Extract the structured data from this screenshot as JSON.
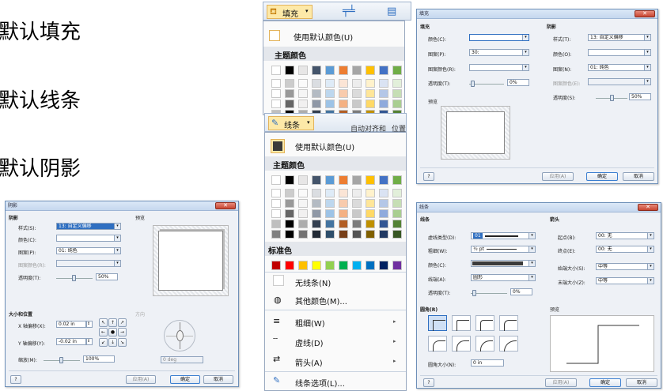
{
  "slide_text": {
    "line1": "默认填充",
    "line2": "默认线条",
    "line3": "默认阴影"
  },
  "colors": {
    "accent": "#2f6fc1",
    "menu_hover": "#fde9a8",
    "close": "#c84631"
  },
  "fill_menu": {
    "button_label": "填充",
    "default_color": "使用默认颜色(U)",
    "theme_colors": "主题颜色"
  },
  "line_menu": {
    "button_label": "线条",
    "ribbon_partial": "自动对齐和",
    "ribbon_partial2": "位置",
    "default_color": "使用默认颜色(U)",
    "theme_colors": "主题颜色",
    "standard_colors": "标准色",
    "no_line": "无线条(N)",
    "more_colors": "其他颜色(M)...",
    "weight": "粗细(W)",
    "dashes": "虚线(D)",
    "arrows": "箭头(A)",
    "line_options": "线条选项(L)..."
  },
  "fill_dialog": {
    "title": "填充",
    "fill_section": "填充",
    "color_label": "颜色(C):",
    "pattern_label": "图案(P):",
    "pattern_value": "30:",
    "pattern_color_label": "图案颜色(R):",
    "transparency_label": "透明度(T):",
    "transparency_value": "0%",
    "preview_label": "预览",
    "shadow_section": "阴影",
    "style_label": "样式(T):",
    "style_value": "13: 自定义偏移",
    "shadow_color_label": "颜色(O):",
    "shadow_pattern_label": "图案(N):",
    "shadow_pattern_value": "01: 纯色",
    "shadow_pattern_color_label": "图案颜色(E):",
    "shadow_transparency_label": "透明度(S):",
    "shadow_transparency_value": "50%",
    "apply": "应用(A)",
    "ok": "确定",
    "cancel": "取消"
  },
  "shadow_dialog": {
    "title": "阴影",
    "shadow_section": "阴影",
    "style_label": "样式(S):",
    "style_value": "13: 自定义偏移",
    "color_label": "颜色(C):",
    "pattern_label": "图案(P):",
    "pattern_value": "01: 纯色",
    "pattern_color_label": "图案颜色(R):",
    "transparency_label": "透明度(T):",
    "transparency_value": "50%",
    "preview_label": "预览",
    "size_section": "大小和位置",
    "direction_label": "方向",
    "x_offset_label": "X 轴偏移(X):",
    "x_offset_value": "0.02 in",
    "y_offset_label": "Y 轴偏移(Y):",
    "y_offset_value": "-0.02 in",
    "scale_label": "缩放(M):",
    "scale_value": "100%",
    "angle_value": "0 deg",
    "apply": "应用(A)",
    "ok": "确定",
    "cancel": "取消"
  },
  "line_dialog": {
    "title": "线条",
    "line_section": "线条",
    "dash_label": "虚线类型(D):",
    "dash_value": "01",
    "weight_label": "粗细(W):",
    "weight_value": "½ pt",
    "color_label": "颜色(C):",
    "cap_label": "线端(A):",
    "cap_value": "圆形",
    "transparency_label": "透明度(T):",
    "transparency_value": "0%",
    "arrows_section": "箭头",
    "begin_label": "起点(B):",
    "begin_value": "00: 无",
    "end_label": "终点(E):",
    "end_value": "00: 无",
    "begin_size_label": "始端大小(S):",
    "begin_size_value": "中等",
    "end_size_label": "末端大小(Z):",
    "end_size_value": "中等",
    "corner_section": "圆角(R)",
    "preview_label": "预览",
    "corner_size_label": "圆角大小(N):",
    "corner_size_value": "0 in",
    "apply": "应用(A)",
    "ok": "确定",
    "cancel": "取消"
  }
}
